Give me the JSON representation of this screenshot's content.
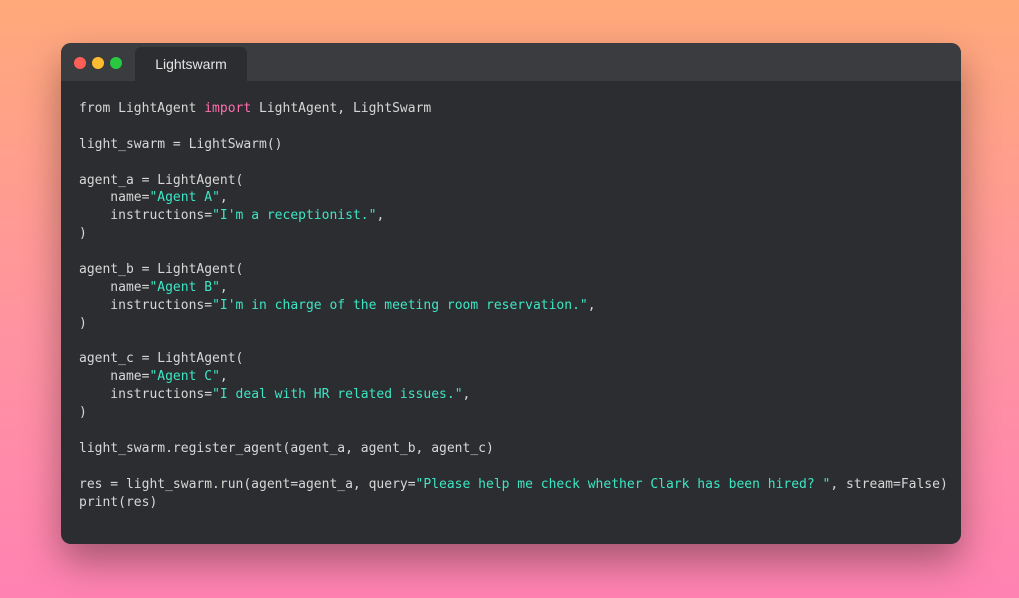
{
  "window": {
    "tab_title": "Lightswarm"
  },
  "code": {
    "lines": [
      [
        {
          "t": "from LightAgent "
        },
        {
          "t": "import",
          "k": "kw"
        },
        {
          "t": " LightAgent, LightSwarm"
        }
      ],
      [],
      [
        {
          "t": "light_swarm = LightSwarm()"
        }
      ],
      [],
      [
        {
          "t": "agent_a = LightAgent("
        }
      ],
      [
        {
          "t": "    name="
        },
        {
          "t": "\"Agent A\"",
          "k": "str"
        },
        {
          "t": ","
        }
      ],
      [
        {
          "t": "    instructions="
        },
        {
          "t": "\"I'm a receptionist.\"",
          "k": "str"
        },
        {
          "t": ","
        }
      ],
      [
        {
          "t": ")"
        }
      ],
      [],
      [
        {
          "t": "agent_b = LightAgent("
        }
      ],
      [
        {
          "t": "    name="
        },
        {
          "t": "\"Agent B\"",
          "k": "str"
        },
        {
          "t": ","
        }
      ],
      [
        {
          "t": "    instructions="
        },
        {
          "t": "\"I'm in charge of the meeting room reservation.\"",
          "k": "str"
        },
        {
          "t": ","
        }
      ],
      [
        {
          "t": ")"
        }
      ],
      [],
      [
        {
          "t": "agent_c = LightAgent("
        }
      ],
      [
        {
          "t": "    name="
        },
        {
          "t": "\"Agent C\"",
          "k": "str"
        },
        {
          "t": ","
        }
      ],
      [
        {
          "t": "    instructions="
        },
        {
          "t": "\"I deal with HR related issues.\"",
          "k": "str"
        },
        {
          "t": ","
        }
      ],
      [
        {
          "t": ")"
        }
      ],
      [],
      [
        {
          "t": "light_swarm.register_agent(agent_a, agent_b, agent_c)"
        }
      ],
      [],
      [
        {
          "t": "res = light_swarm.run(agent=agent_a, query="
        },
        {
          "t": "\"Please help me check whether Clark has been hired? \"",
          "k": "str"
        },
        {
          "t": ", stream=False)"
        }
      ],
      [
        {
          "t": "print(res)"
        }
      ]
    ]
  }
}
